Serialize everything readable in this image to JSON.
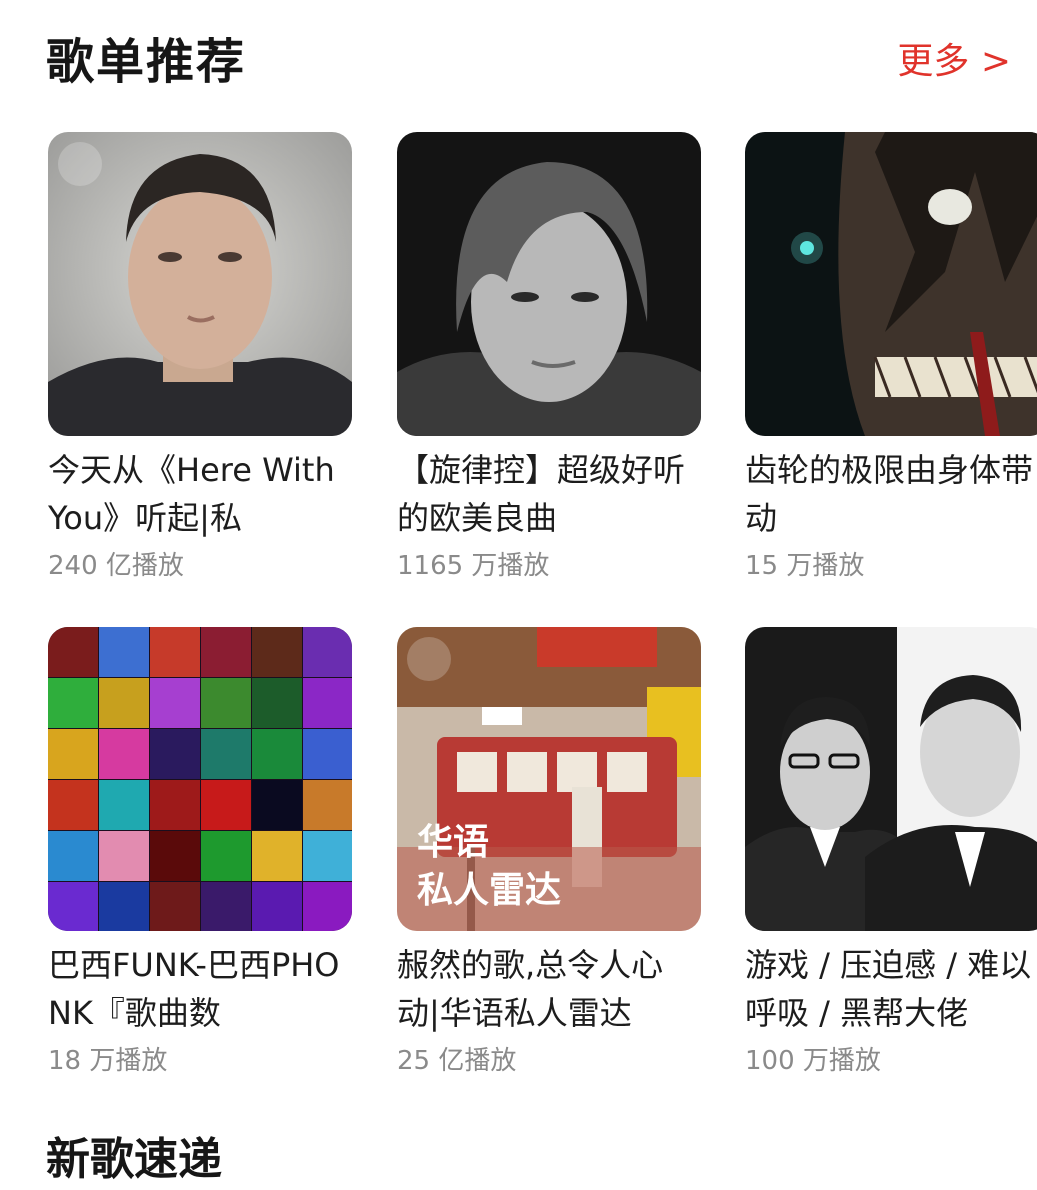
{
  "header": {
    "title": "歌单推荐",
    "more_label": "更多 >"
  },
  "colors": {
    "accent": "#e0332b",
    "secondary_text": "#8a8a8a"
  },
  "playlists": [
    {
      "title": "今天从《Here With You》听起|私",
      "plays": "240 亿播放",
      "cover_overlay": ""
    },
    {
      "title": "【旋律控】超级好听的欧美良曲",
      "plays": "1165 万播放",
      "cover_overlay": ""
    },
    {
      "title": "齿轮的极限由身体带动",
      "plays": "15 万播放",
      "cover_overlay": ""
    },
    {
      "title": "巴西FUNK-巴西PHONK『歌曲数",
      "plays": "18 万播放",
      "cover_overlay": ""
    },
    {
      "title": "赧然的歌,总令人心动|华语私人雷达",
      "plays": "25 亿播放",
      "cover_overlay": "华语\n私人雷达"
    },
    {
      "title": "游戏 / 压迫感 / 难以呼吸 / 黑帮大佬",
      "plays": "100 万播放",
      "cover_overlay": ""
    }
  ],
  "next_section": {
    "title": "新歌速递"
  }
}
